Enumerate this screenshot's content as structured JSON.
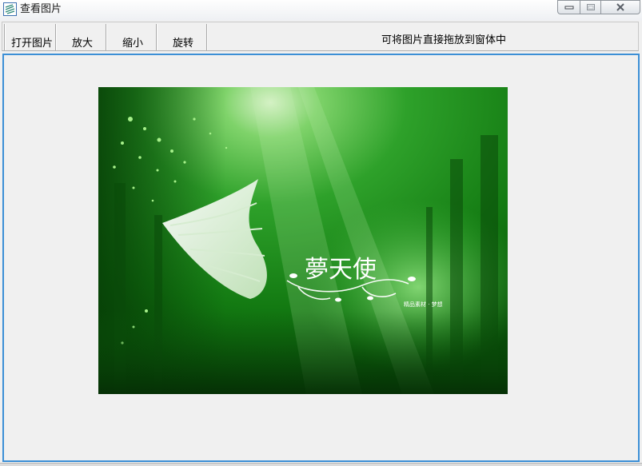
{
  "window": {
    "title": "查看图片"
  },
  "toolbar": {
    "open_label": "打开图片",
    "zoom_in_label": "放大",
    "zoom_out_label": "缩小",
    "rotate_label": "旋转",
    "hint": "可将图片直接拖放到窗体中"
  },
  "picture": {
    "artwork_title": "夢天使",
    "artwork_caption": "精品素材 · 梦想"
  },
  "colors": {
    "panel_border": "#3c8fd6",
    "image_green_dark": "#0b4d0b",
    "image_green_light": "#5fd35f"
  }
}
